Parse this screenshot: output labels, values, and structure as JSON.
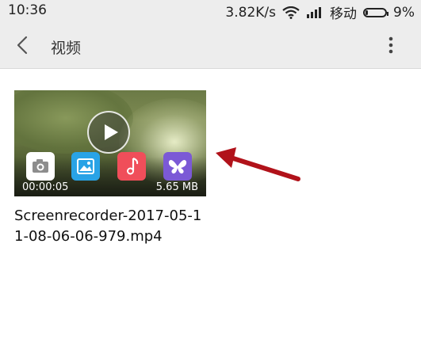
{
  "status_bar": {
    "time": "10:36",
    "network_speed": "3.82K/s",
    "carrier": "移动",
    "battery": "9%",
    "wifi_icon": "wifi-icon",
    "signal_icon": "signal-icon",
    "battery_icon": "battery-icon"
  },
  "header": {
    "title": "视频",
    "back_icon": "chevron-left-icon",
    "more_icon": "more-vertical-icon"
  },
  "video": {
    "duration": "00:00:05",
    "file_size": "5.65 MB",
    "file_name": "Screenrecorder-2017-05-11-08-06-06-979.mp4",
    "thumbnail_apps": [
      "camera-icon",
      "gallery-icon",
      "music-icon",
      "theme-icon"
    ]
  },
  "colors": {
    "accent_arrow": "#b1121a",
    "bar_bg": "#ededed"
  }
}
